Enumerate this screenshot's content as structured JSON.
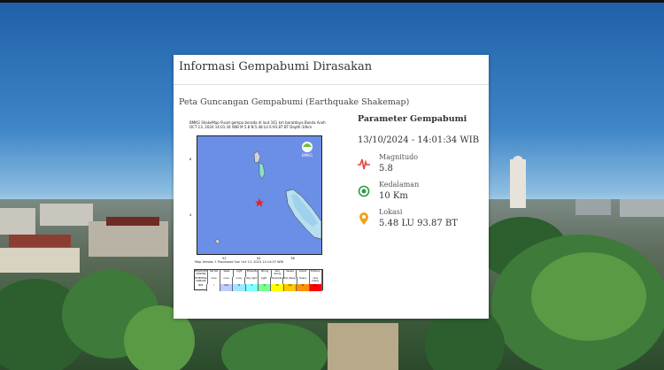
{
  "card": {
    "title": "Informasi Gempabumi Dirasakan",
    "map_caption": "Peta Guncangan Gempabumi (Earthquake Shakemap)"
  },
  "shakemap": {
    "brand": "BMKG ShakeMap",
    "header_line": "Pusat gempa berada di laut 161 km baratdaya Banda Aceh",
    "sub_line": "OCT 13, 2024 14:01:34 WIB M 5.8 N:5.48 LU E:93.87 BT Depth:10km",
    "logo_label": "BMKG",
    "foot_line": "Map Version 1 Processed Sun Oct 13, 2024 14:14:07 WIB",
    "legend_rows": [
      [
        "PERCEIVED SHAKING",
        "Not felt",
        "Weak",
        "Light",
        "Moderate",
        "Strong",
        "Very strong",
        "Severe",
        "Violent",
        "Extreme"
      ],
      [
        "POTENTIAL DAMAGE",
        "none",
        "none",
        "none",
        "Very light",
        "Light",
        "Moderate",
        "Mod./Heavy",
        "Heavy",
        "Very Heavy"
      ],
      [
        "MMI",
        "I",
        "II-III",
        "IV",
        "V",
        "VI",
        "VII",
        "VIII",
        "IX",
        "X+"
      ]
    ],
    "legend_colors": [
      "#ffffff",
      "#ffffff",
      "#bfccff",
      "#a0e6ff",
      "#80ffff",
      "#7aff93",
      "#ffff00",
      "#ffc800",
      "#ff9100",
      "#ff0000"
    ],
    "tick_labels_x": [
      "92",
      "94",
      "96"
    ],
    "tick_labels_y": [
      "6",
      "4"
    ]
  },
  "params": {
    "title": "Parameter Gempabumi",
    "datetime": "13/10/2024 - 14:01:34 WIB",
    "items": [
      {
        "label": "Magnitudo",
        "value": "5.8",
        "icon": "seismograph-icon",
        "color": "#e0463c"
      },
      {
        "label": "Kedalaman",
        "value": "10 Km",
        "icon": "depth-icon",
        "color": "#2a9d3f"
      },
      {
        "label": "Lokasi",
        "value": "5.48 LU 93.87 BT",
        "icon": "location-pin-icon",
        "color": "#f2a31b"
      }
    ]
  }
}
